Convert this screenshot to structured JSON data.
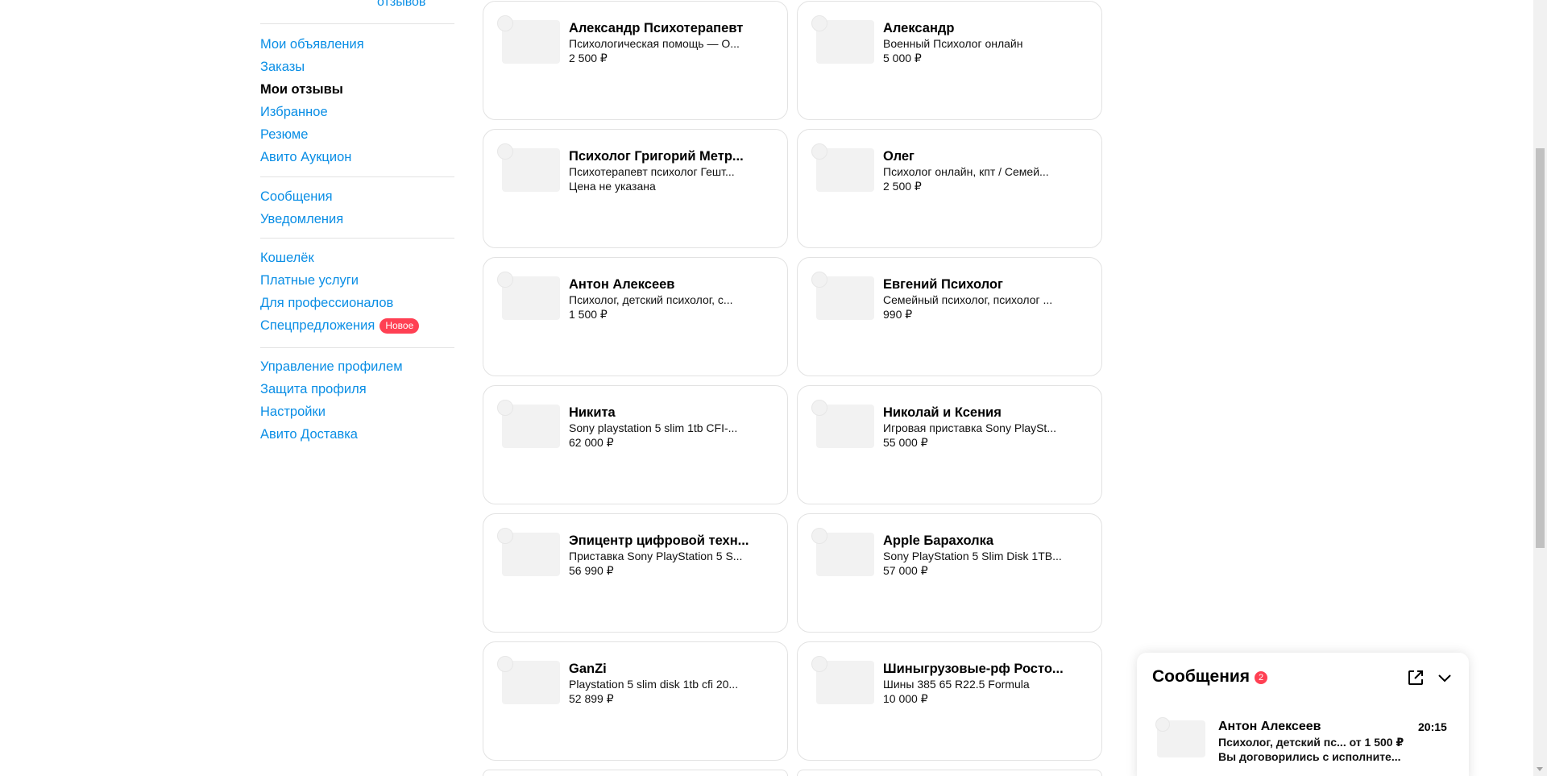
{
  "sidebar": {
    "top_link": "отзывов",
    "group1": [
      "Мои объявления",
      "Заказы",
      "Мои отзывы",
      "Избранное",
      "Резюме",
      "Авито Аукцион"
    ],
    "group2": [
      "Сообщения",
      "Уведомления"
    ],
    "group3": [
      "Кошелёк",
      "Платные услуги",
      "Для профессионалов",
      "Спецпредложения"
    ],
    "new_badge": "Новое",
    "group4": [
      "Управление профилем",
      "Защита профиля",
      "Настройки",
      "Авито Доставка"
    ],
    "active_item": "Мои отзывы"
  },
  "cards": [
    {
      "name": "Александр Психотерапевт",
      "desc": "Психологическая помощь — О...",
      "price": "2 500 ₽"
    },
    {
      "name": "Александр",
      "desc": "Военный Психолог онлайн",
      "price": "5 000 ₽"
    },
    {
      "name": "Психолог Григорий Метр...",
      "desc": "Психотерапевт психолог Гешт...",
      "price": "Цена не указана"
    },
    {
      "name": "Олег",
      "desc": "Психолог онлайн, кпт / Семей...",
      "price": "2 500 ₽"
    },
    {
      "name": "Антон Алексеев",
      "desc": "Психолог, детский психолог, с...",
      "price": "1 500 ₽"
    },
    {
      "name": "Евгений Психолог",
      "desc": "Семейный психолог, психолог ...",
      "price": "990 ₽"
    },
    {
      "name": "Никита",
      "desc": "Sony playstation 5 slim 1tb CFI-...",
      "price": "62 000 ₽"
    },
    {
      "name": "Николай и Ксения",
      "desc": "Игровая приставка Sony PlaySt...",
      "price": "55 000 ₽"
    },
    {
      "name": "Эпицентр цифровой техн...",
      "desc": "Приставка Sony PlayStation 5 S...",
      "price": "56 990 ₽"
    },
    {
      "name": "Apple Барахолка",
      "desc": "Sony PlayStation 5 Slim Disk 1TB...",
      "price": "57 000 ₽"
    },
    {
      "name": "GanZi",
      "desc": "Playstation 5 slim disk 1tb cfi 20...",
      "price": "52 899 ₽"
    },
    {
      "name": "Шиныгрузовые-рф Росто...",
      "desc": "Шины 385 65 R22.5 Formula",
      "price": "10 000 ₽"
    }
  ],
  "messenger": {
    "title": "Сообщения",
    "unread_count": "2",
    "message": {
      "name": "Антон Алексеев",
      "time": "20:15",
      "line1": "Психолог, детский пс... от 1 500 ₽",
      "line2": "Вы договорились с исполните..."
    }
  },
  "colors": {
    "link": "#0a8ee5",
    "badge": "#ff4053"
  }
}
